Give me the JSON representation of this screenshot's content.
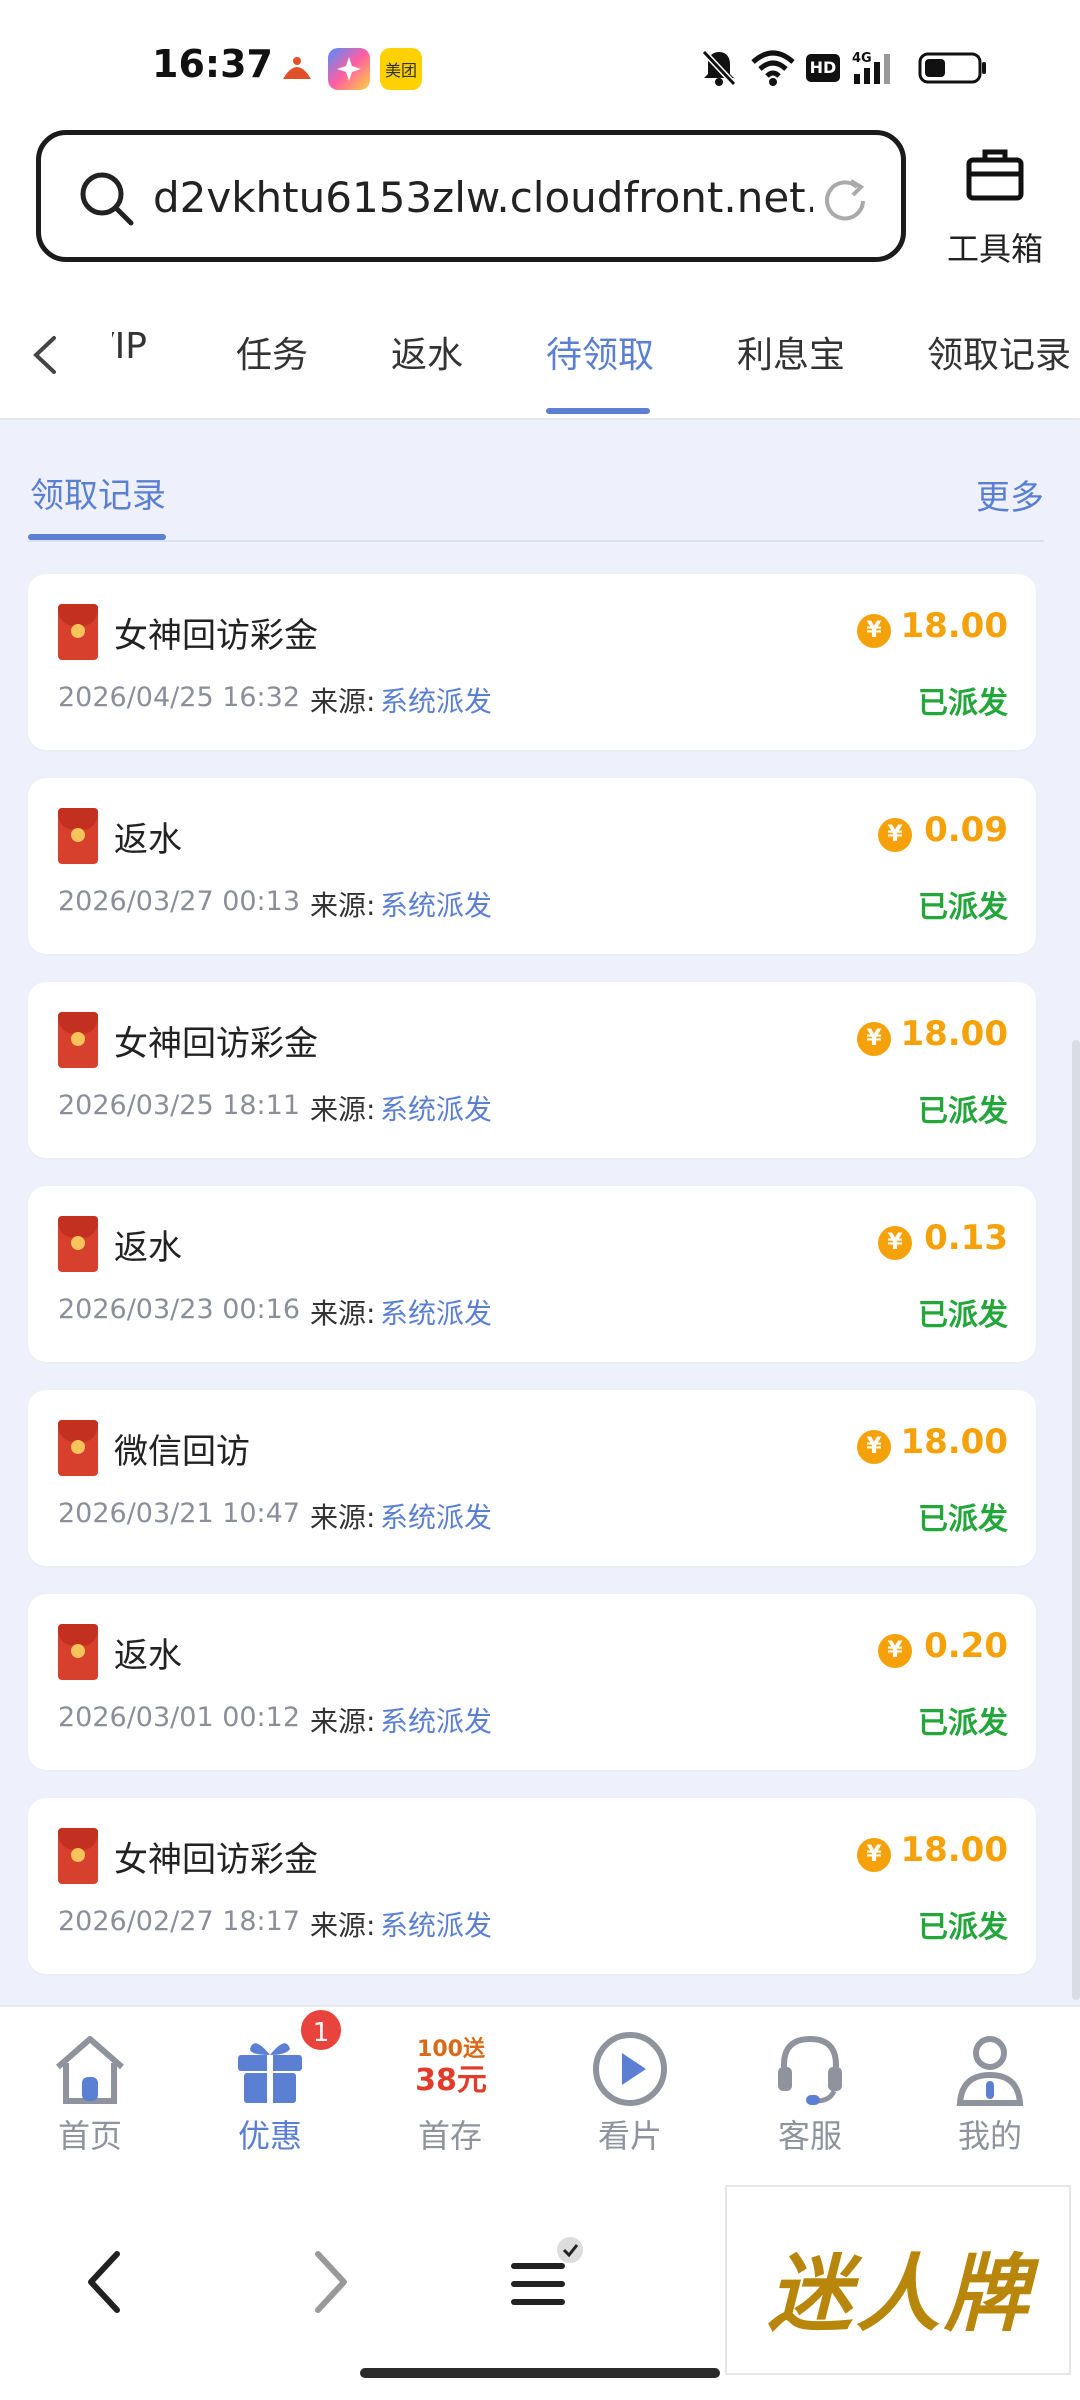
{
  "status_bar": {
    "time": "16:37",
    "app_icons": [
      "ad-icon",
      "gallery-icon",
      "meituan-icon"
    ],
    "meituan_label": "美团",
    "network_label": "4G",
    "hd_label": "HD"
  },
  "url_bar": {
    "url": "d2vkhtu6153zlw.cloudfront.net..."
  },
  "toolbox": {
    "label": "工具箱"
  },
  "tabs": [
    {
      "label": "VIP"
    },
    {
      "label": "任务"
    },
    {
      "label": "返水"
    },
    {
      "label": "待领取"
    },
    {
      "label": "利息宝"
    },
    {
      "label": "领取记录"
    }
  ],
  "section": {
    "title": "领取记录",
    "more": "更多"
  },
  "records": [
    {
      "title": "女神回访彩金",
      "date": "2026/04/25 16:32",
      "source_label": "来源:",
      "source": "系统派发",
      "amount": "18.00",
      "status": "已派发"
    },
    {
      "title": "返水",
      "date": "2026/03/27 00:13",
      "source_label": "来源:",
      "source": "系统派发",
      "amount": "0.09",
      "status": "已派发"
    },
    {
      "title": "女神回访彩金",
      "date": "2026/03/25 18:11",
      "source_label": "来源:",
      "source": "系统派发",
      "amount": "18.00",
      "status": "已派发"
    },
    {
      "title": "返水",
      "date": "2026/03/23 00:16",
      "source_label": "来源:",
      "source": "系统派发",
      "amount": "0.13",
      "status": "已派发"
    },
    {
      "title": "微信回访",
      "date": "2026/03/21 10:47",
      "source_label": "来源:",
      "source": "系统派发",
      "amount": "18.00",
      "status": "已派发"
    },
    {
      "title": "返水",
      "date": "2026/03/01 00:12",
      "source_label": "来源:",
      "source": "系统派发",
      "amount": "0.20",
      "status": "已派发"
    },
    {
      "title": "女神回访彩金",
      "date": "2026/02/27 18:17",
      "source_label": "来源:",
      "source": "系统派发",
      "amount": "18.00",
      "status": "已派发"
    }
  ],
  "coin_symbol": "¥",
  "bottom_nav": [
    {
      "label": "首页",
      "icon": "home-icon"
    },
    {
      "label": "优惠",
      "icon": "gift-icon",
      "badge": "1"
    },
    {
      "label": "首存",
      "icon": "promo-icon",
      "promo_top": "100送",
      "promo_bottom": "38元"
    },
    {
      "label": "看片",
      "icon": "play-icon"
    },
    {
      "label": "客服",
      "icon": "headset-icon"
    },
    {
      "label": "我的",
      "icon": "user-icon"
    }
  ],
  "ad": {
    "text": "迷人牌"
  },
  "colors": {
    "accent": "#5b7fd3",
    "amount": "#f5a20a",
    "status_ok": "#23a63a",
    "badge": "#e8433c"
  }
}
